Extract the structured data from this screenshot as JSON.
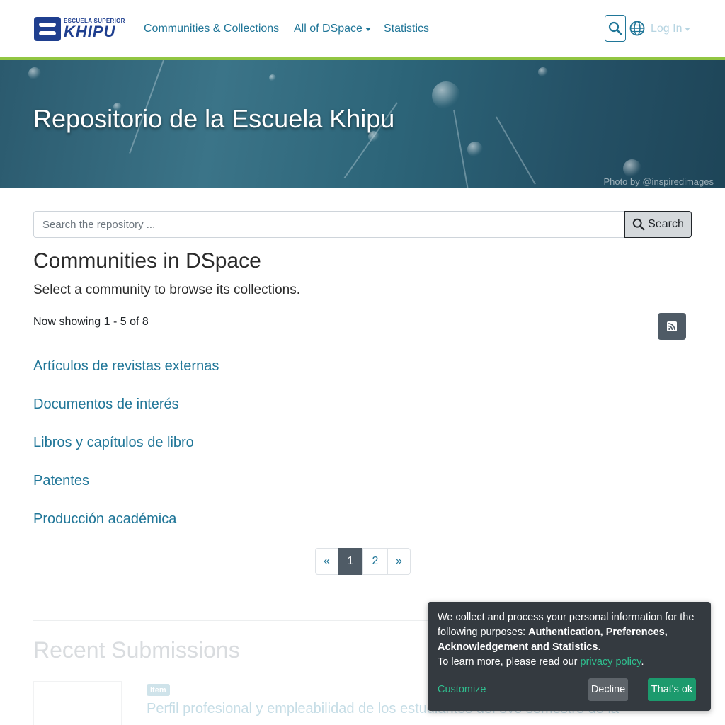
{
  "header": {
    "logo_small": "ESCUELA SUPERIOR",
    "logo_big": "KHIPU",
    "nav": {
      "communities": "Communities & Collections",
      "all": "All of DSpace",
      "statistics": "Statistics"
    },
    "login": "Log In"
  },
  "banner": {
    "title": "Repositorio de la Escuela Khipu",
    "credit": "Photo by @inspiredimages"
  },
  "search": {
    "placeholder": "Search the repository ...",
    "button": "Search"
  },
  "main": {
    "heading": "Communities in DSpace",
    "subtext": "Select a community to browse its collections.",
    "showing": "Now showing 1 - 5 of 8",
    "communities": [
      "Artículos de revistas externas",
      "Documentos de interés",
      "Libros y capítulos de libro",
      "Patentes",
      "Producción académica"
    ],
    "pagination": {
      "prev": "«",
      "pages": [
        "1",
        "2"
      ],
      "next": "»",
      "current": "1"
    }
  },
  "recent": {
    "heading": "Recent Submissions",
    "item_badge": "Item",
    "item_title": "Perfil profesional y empleabilidad de los estudiantes del 8vo semestre de la"
  },
  "consent": {
    "intro": "We collect and process your personal information for the following purposes: ",
    "purposes": "Authentication, Preferences, Acknowledgement and Statistics",
    "period": ".",
    "learn_more": "To learn more, please read our ",
    "policy_link": "privacy policy",
    "policy_period": ".",
    "customize": "Customize",
    "decline": "Decline",
    "accept": "That's ok"
  },
  "colors": {
    "link": "#207698",
    "accent_bar": "#92c642",
    "consent_bg": "#343a40",
    "consent_accept": "#1c9a6d"
  }
}
